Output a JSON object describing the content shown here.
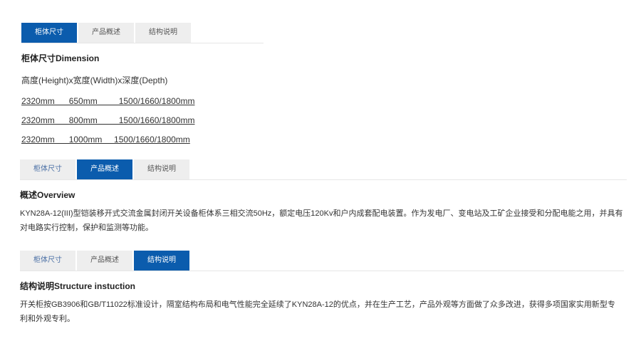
{
  "tabs": [
    "柜体尺寸",
    "产品概述",
    "结构说明"
  ],
  "dimension": {
    "heading": "柜体尺寸Dimension",
    "subtitle": "高度(Height)x宽度(Width)x深度(Depth)",
    "rows": [
      "2320mm      650mm         1500/1660/1800mm",
      "2320mm      800mm         1500/1660/1800mm",
      "2320mm      1000mm     1500/1660/1800mm"
    ]
  },
  "overview": {
    "heading": "概述Overview",
    "text": "KYN28A-12(III)型铠装移开式交流金属封闭开关设备柜体系三相交流50Hz，额定电压120Kv和户内成套配电装置。作为发电厂、变电站及工矿企业接受和分配电能之用，并具有对电路实行控制，保护和监测等功能。"
  },
  "structure": {
    "heading": "结构说明Structure instuction",
    "text": "开关柜按GB3906和GB/T11022标准设计，隔室结构布局和电气性能完全延续了KYN28A-12的优点，并在生产工艺，产品外观等方面做了众多改进，获得多项国家实用新型专利和外观专利。"
  },
  "colors": {
    "active_tab": "#0b5cad",
    "inactive_tab": "#eeeeee"
  }
}
